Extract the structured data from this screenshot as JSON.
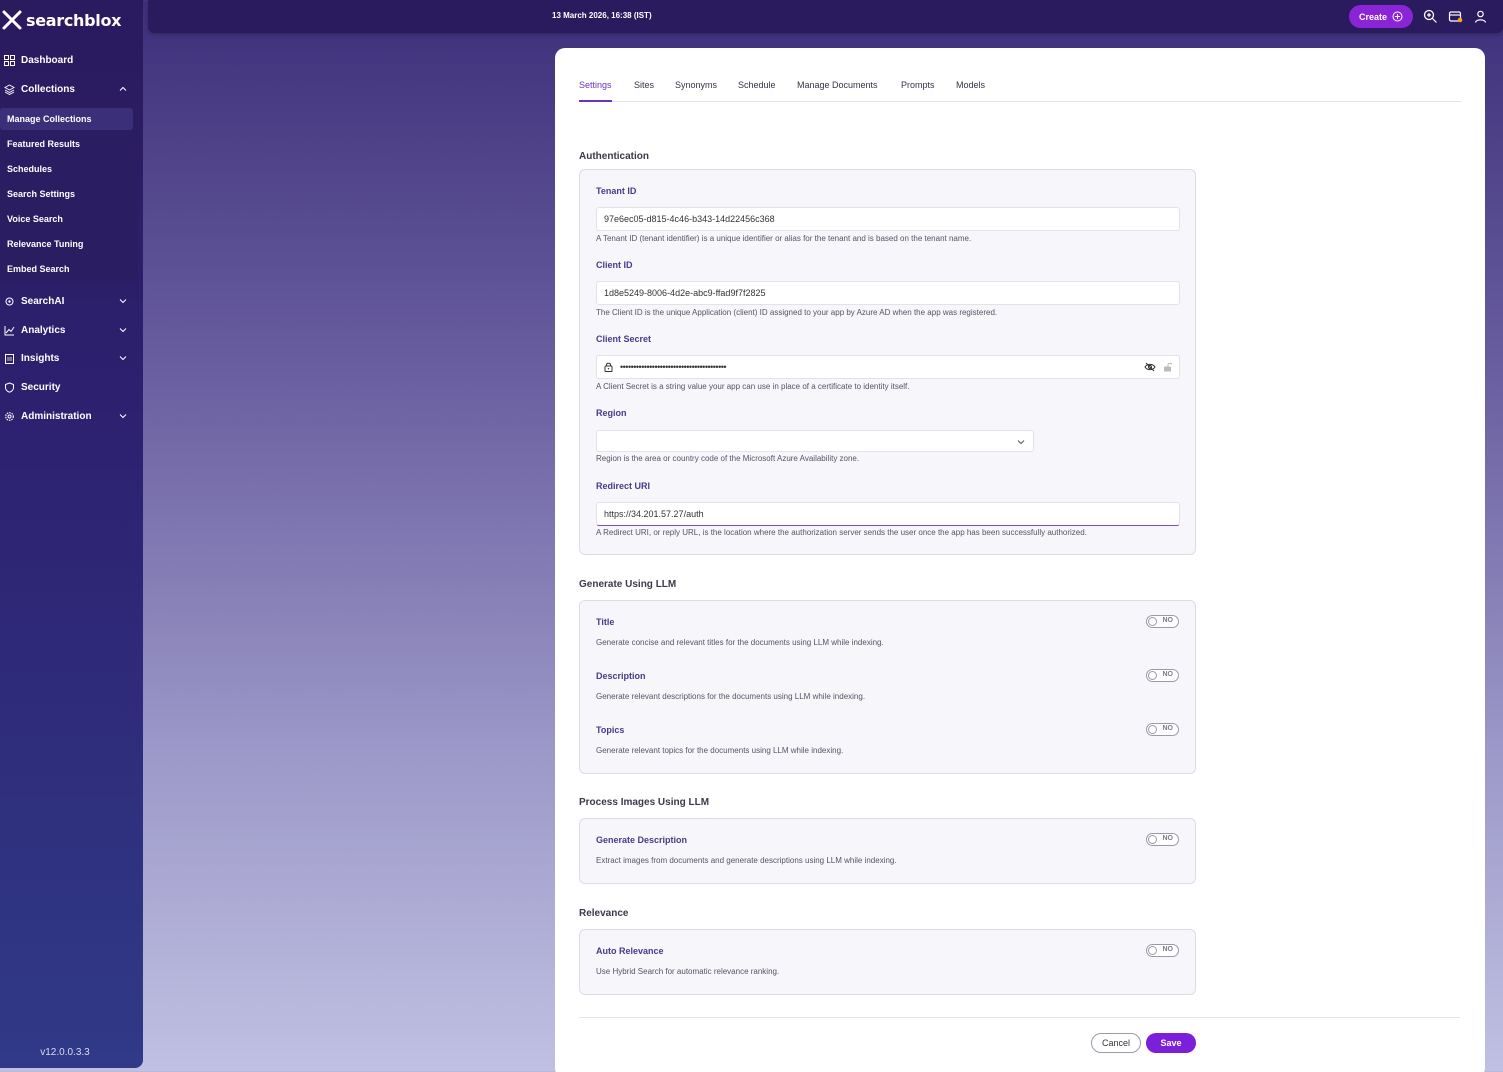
{
  "app": {
    "brand": "searchblox",
    "version": "v12.0.0.3.3"
  },
  "topbar": {
    "datetime": "13 March 2026, 16:38 (IST)",
    "create_label": "Create"
  },
  "sidebar": {
    "dashboard": "Dashboard",
    "collections": "Collections",
    "collections_sub": [
      "Manage Collections",
      "Featured Results",
      "Schedules",
      "Search Settings",
      "Voice Search",
      "Relevance Tuning",
      "Embed Search"
    ],
    "searchai": "SearchAI",
    "analytics": "Analytics",
    "insights": "Insights",
    "security": "Security",
    "administration": "Administration"
  },
  "tabs": [
    "Settings",
    "Sites",
    "Synonyms",
    "Schedule",
    "Manage Documents",
    "Prompts",
    "Models"
  ],
  "auth": {
    "title": "Authentication",
    "tenant_label": "Tenant ID",
    "tenant_value": "97e6ec05-d815-4c46-b343-14d22456c368",
    "tenant_help": "A Tenant ID (tenant identifier) is a unique identifier or alias for the tenant and is based on the tenant name.",
    "client_label": "Client ID",
    "client_value": "1d8e5249-8006-4d2e-abc9-ffad9f7f2825",
    "client_help": "The Client ID is the unique Application (client) ID assigned to your app by Azure AD when the app was registered.",
    "secret_label": "Client Secret",
    "secret_value": "••••••••••••••••••••••••••••••••••••••••",
    "secret_help": "A Client Secret is a string value your app can use in place of a certificate to identity itself.",
    "region_label": "Region",
    "region_value": "",
    "region_help": "Region is the area or country code of the Microsoft Azure Availability zone.",
    "redirect_label": "Redirect URI",
    "redirect_value": "https://34.201.57.27/auth",
    "redirect_help": "A Redirect URI, or reply URL, is the location where the authorization server sends the user once the app has been successfully authorized."
  },
  "llm": {
    "title": "Generate Using LLM",
    "items": [
      {
        "label": "Title",
        "help": "Generate concise and relevant titles for the documents using LLM while indexing.",
        "state": "NO"
      },
      {
        "label": "Description",
        "help": "Generate relevant descriptions for the documents using LLM while indexing.",
        "state": "NO"
      },
      {
        "label": "Topics",
        "help": "Generate relevant topics for the documents using LLM while indexing.",
        "state": "NO"
      }
    ]
  },
  "images": {
    "title": "Process Images Using LLM",
    "label": "Generate Description",
    "help": "Extract images from documents and generate descriptions using LLM while indexing.",
    "state": "NO"
  },
  "relevance": {
    "title": "Relevance",
    "label": "Auto Relevance",
    "help": "Use Hybrid Search for automatic relevance ranking.",
    "state": "NO"
  },
  "actions": {
    "cancel": "Cancel",
    "save": "Save"
  }
}
